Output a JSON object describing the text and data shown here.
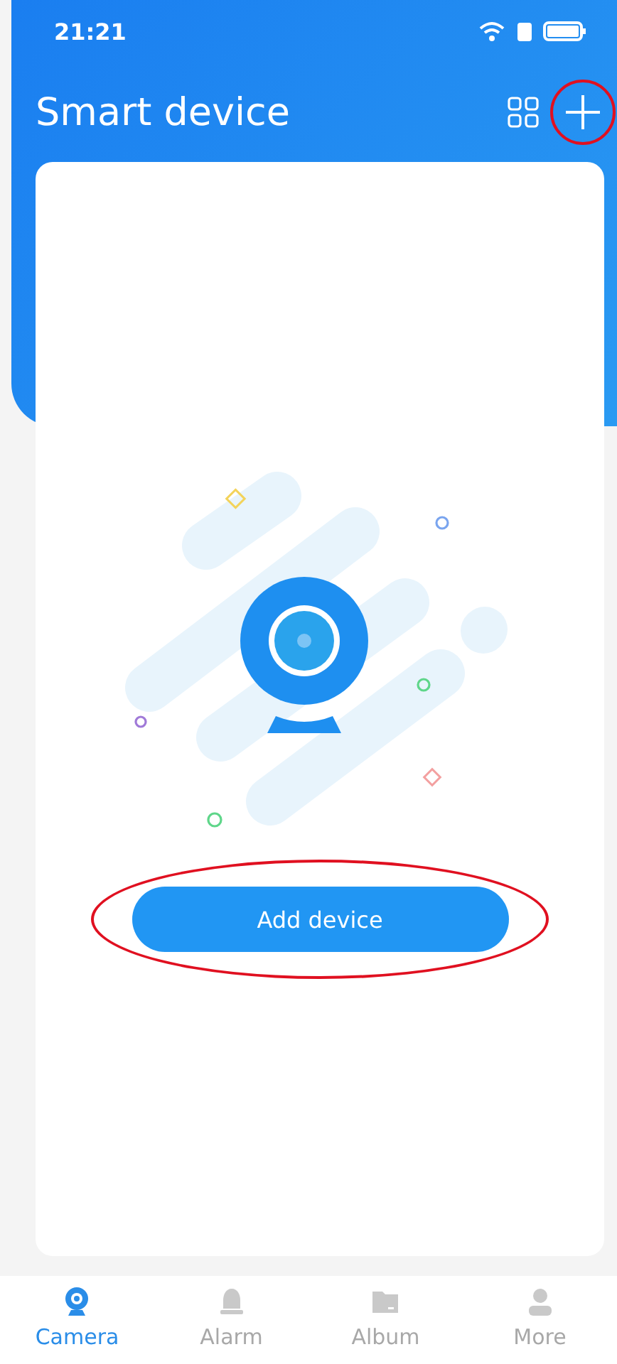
{
  "status_bar": {
    "time": "21:21"
  },
  "header": {
    "title": "Smart device",
    "add_highlighted": true
  },
  "empty_state": {
    "button": "Add device",
    "button_highlighted": true
  },
  "tabs": [
    {
      "label": "Camera",
      "selected": true,
      "kind": "camera"
    },
    {
      "label": "Alarm",
      "selected": false,
      "kind": "alarm"
    },
    {
      "label": "Album",
      "selected": false,
      "kind": "album"
    },
    {
      "label": "More",
      "selected": false,
      "kind": "more"
    }
  ]
}
